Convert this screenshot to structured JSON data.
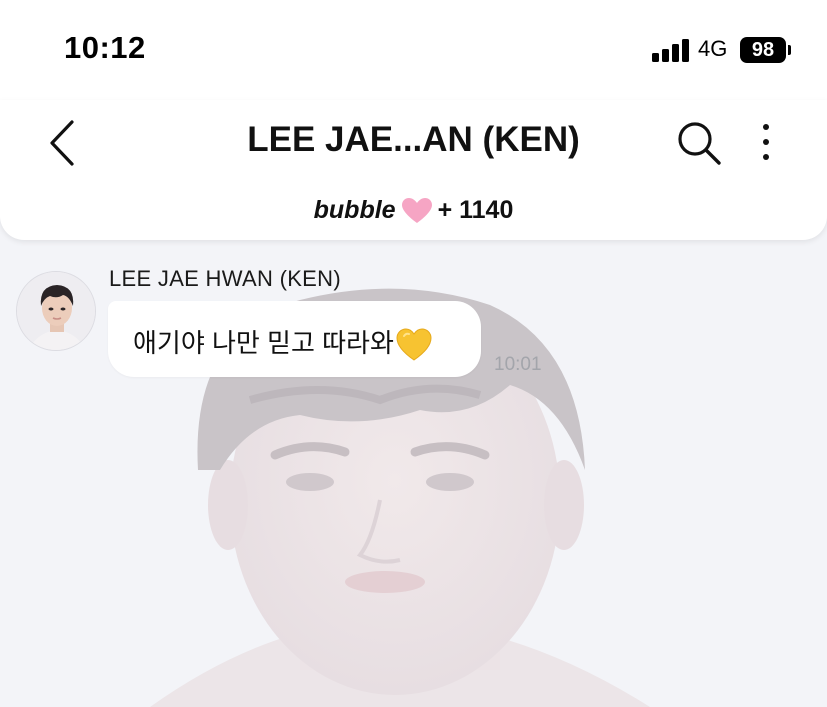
{
  "status_bar": {
    "time": "10:12",
    "network": "4G",
    "battery": "98"
  },
  "header": {
    "title": "LEE JAE...AN (KEN)",
    "bubble_logo": "bubble",
    "bubble_count": "+ 1140",
    "icons": [
      "chevron-left-icon",
      "search-icon",
      "more-vertical-icon",
      "heart-icon"
    ]
  },
  "chat": {
    "messages": [
      {
        "sender": "LEE JAE HWAN (KEN)",
        "text": "애기야 나만 믿고 따라와",
        "emoji": "yellow-heart",
        "time": "10:01"
      }
    ]
  },
  "colors": {
    "background": "#f3f4f8",
    "heart_pink": "#f6a5c4",
    "emoji_yellow": "#f7c331",
    "timestamp_gray": "#a3a5ab"
  }
}
